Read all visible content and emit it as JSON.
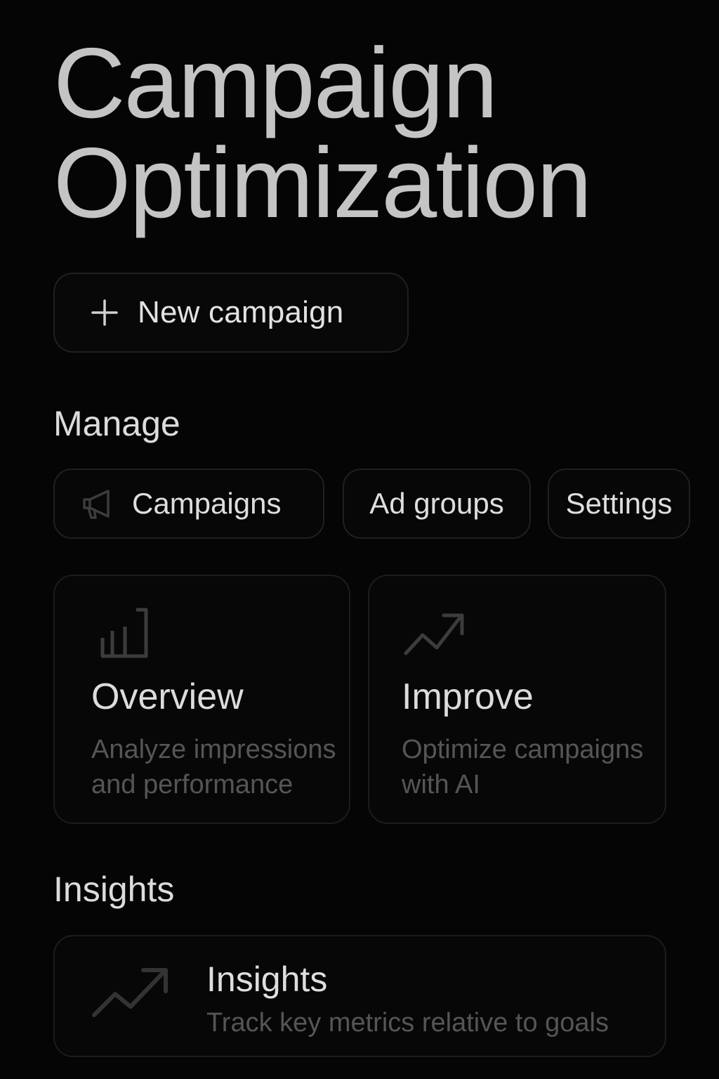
{
  "header": {
    "title_line1": "Campaign",
    "title_line2": "Optimization"
  },
  "actions": {
    "new_campaign": {
      "label": "New campaign",
      "icon": "plus-icon"
    }
  },
  "manage": {
    "heading": "Manage",
    "chips": [
      {
        "label": "Campaigns",
        "icon": "megaphone-icon"
      },
      {
        "label": "Ad groups"
      },
      {
        "label": "Settings"
      }
    ],
    "cards": [
      {
        "title": "Overview",
        "description": "Analyze impressions and performance",
        "icon": "bar-chart-icon"
      },
      {
        "title": "Improve",
        "description": "Optimize campaigns with AI",
        "icon": "trending-up-icon"
      }
    ]
  },
  "insights": {
    "heading": "Insights",
    "card": {
      "title": "Insights",
      "description": "Track key metrics relative to goals",
      "icon": "trending-up-icon"
    }
  },
  "colors": {
    "background": "#050505",
    "border": "#1c1c1c",
    "title": "#c4c4c4",
    "text": "#dcdcdc",
    "muted": "#555555",
    "icon": "#3a3a3a"
  }
}
